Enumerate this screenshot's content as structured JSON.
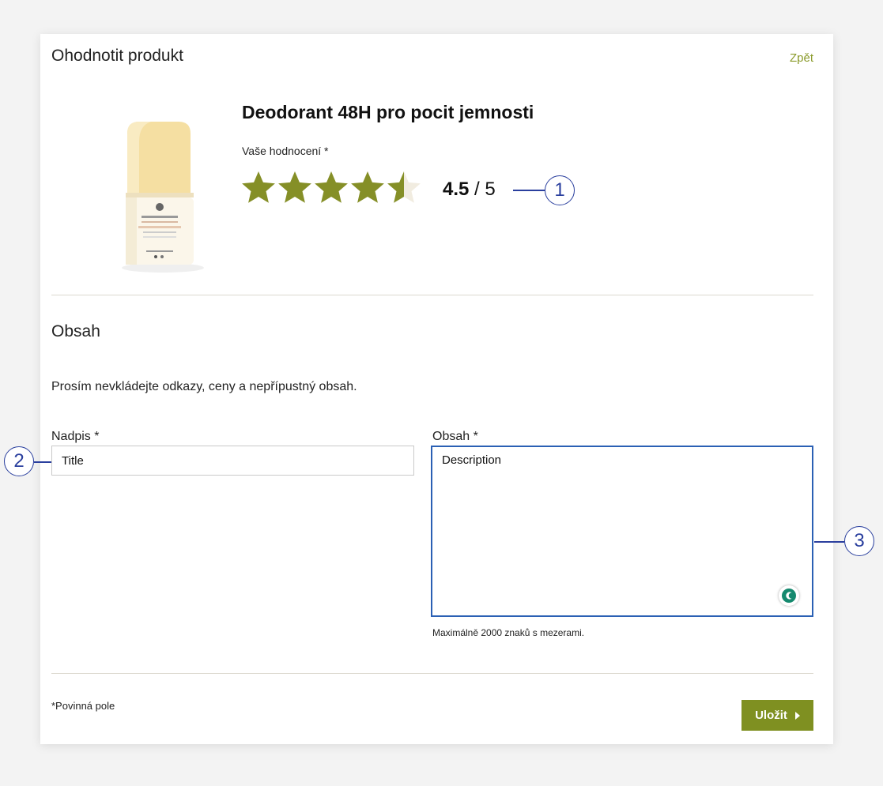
{
  "header": {
    "title": "Ohodnotit produkt",
    "back_label": "Zpět"
  },
  "product": {
    "name": "Deodorant 48H pro pocit jemnosti"
  },
  "rating": {
    "label": "Vaše hodnocení *",
    "value": 4.5,
    "value_text": "4.5",
    "max_text": "/ 5",
    "max": 5,
    "filled_color": "#858f27",
    "empty_color": "#f1ece0"
  },
  "content_section": {
    "title": "Obsah",
    "notice": "Prosím nevkládejte odkazy, ceny a nepřípustný obsah."
  },
  "form": {
    "title_label": "Nadpis *",
    "title_value": "Title",
    "description_label": "Obsah *",
    "description_value": "Description",
    "description_hint": "Maximálně 2000 znaků s mezerami."
  },
  "footer": {
    "required_note": "*Povinná pole",
    "save_label": "Uložit"
  },
  "callouts": {
    "rating": "1",
    "title": "2",
    "description": "3"
  },
  "colors": {
    "accent": "#7f9021",
    "link": "#8a9a2a",
    "focus": "#2b60b4"
  },
  "icons": [
    "star-icon",
    "chevron-right-icon",
    "grammar-check-icon"
  ]
}
